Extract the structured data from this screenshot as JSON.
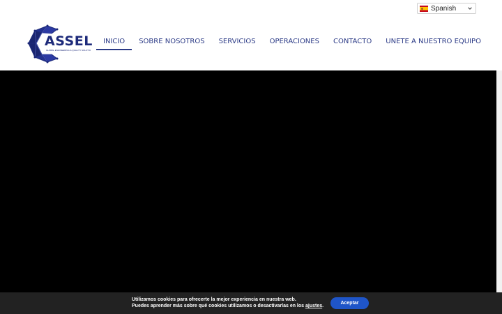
{
  "language_selector": {
    "selected": "Spanish",
    "flag_icon": "spain-flag-icon"
  },
  "logo": {
    "name": "ASSEL",
    "tagline": "GLOBAL ENGINEERING & QUALITY SOLUTIONS",
    "color": "#1d2a7a"
  },
  "nav": {
    "items": [
      {
        "label": "INICIO",
        "active": true
      },
      {
        "label": "SOBRE NOSOTROS",
        "active": false
      },
      {
        "label": "SERVICIOS",
        "active": false
      },
      {
        "label": "OPERACIONES",
        "active": false
      },
      {
        "label": "CONTACTO",
        "active": false
      },
      {
        "label": "UNETE A NUESTRO EQUIPO",
        "active": false
      }
    ]
  },
  "cookie_bar": {
    "line1": "Utilizamos cookies para ofrecerte la mejor experiencia en nuestra web.",
    "line2_prefix": "Puedes aprender más sobre qué cookies utilizamos o desactivarlas en los ",
    "settings_link": "ajustes",
    "line2_suffix": ".",
    "accept_label": "Aceptar",
    "accent": "#1f55c8"
  }
}
